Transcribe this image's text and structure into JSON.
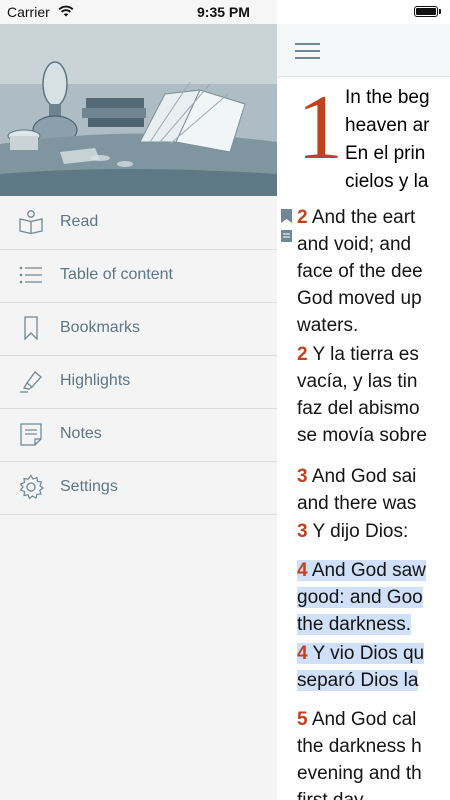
{
  "status": {
    "carrier": "Carrier",
    "time": "9:35 PM"
  },
  "menu": {
    "items": [
      {
        "label": "Read",
        "icon": "book-reader-icon"
      },
      {
        "label": "Table of content",
        "icon": "list-icon"
      },
      {
        "label": "Bookmarks",
        "icon": "bookmark-icon"
      },
      {
        "label": "Highlights",
        "icon": "highlighter-icon"
      },
      {
        "label": "Notes",
        "icon": "note-icon"
      },
      {
        "label": "Settings",
        "icon": "gear-icon"
      }
    ]
  },
  "reader": {
    "chapter_number": "1",
    "intro_lines": [
      "In the beg",
      "heaven ar",
      "En el prin",
      "cielos y la"
    ],
    "verses": [
      {
        "number": "2",
        "lines": [
          "And the eart",
          "and void; and",
          "face of the dee",
          "God moved up",
          "waters."
        ],
        "highlighted": false
      },
      {
        "number": "2",
        "lines": [
          "Y la tierra es",
          "vacía, y las tin",
          "faz del abismo",
          "se movía sobre"
        ],
        "highlighted": false
      },
      {
        "number": "3",
        "lines": [
          "And God sai",
          "and there was"
        ],
        "highlighted": false
      },
      {
        "number": "3",
        "lines": [
          "Y dijo Dios:"
        ],
        "highlighted": false
      },
      {
        "number": "4",
        "lines": [
          "And God saw",
          "good: and Goo",
          "the darkness."
        ],
        "highlighted": true
      },
      {
        "number": "4",
        "lines": [
          "Y vio Dios qu",
          "separó Dios la"
        ],
        "highlighted": true
      },
      {
        "number": "5",
        "lines": [
          "And God cal",
          "the darkness h",
          "evening and th",
          "first day."
        ],
        "highlighted": false
      }
    ]
  },
  "colors": {
    "accent": "#c0421f",
    "menu_text": "#5d7686",
    "highlight": "#cfe0f8"
  }
}
